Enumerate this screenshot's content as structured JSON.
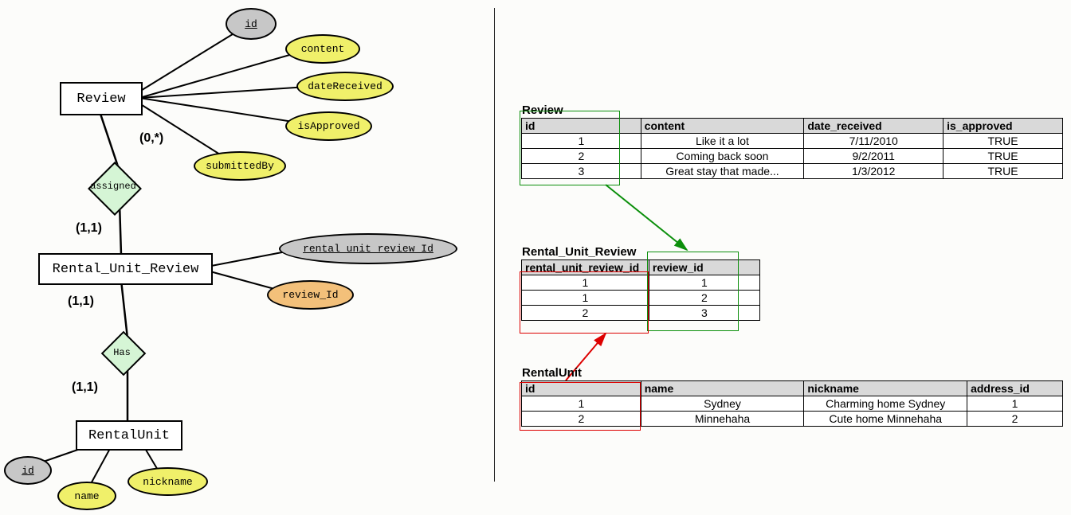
{
  "er": {
    "entities": {
      "review": "Review",
      "rur": "Rental_Unit_Review",
      "ru": "RentalUnit"
    },
    "attrs": {
      "id": "id",
      "content": "content",
      "dateReceived": "dateReceived",
      "isApproved": "isApproved",
      "submittedBy": "submittedBy",
      "rur_id": "rental_unit_review_Id",
      "review_id": "review_Id",
      "ru_id": "id",
      "ru_name": "name",
      "ru_nickname": "nickname"
    },
    "rels": {
      "assigned": "assigned",
      "has": "Has"
    },
    "cards": {
      "c0star": "(0,*)",
      "c11a": "(1,1)",
      "c11b": "(1,1)",
      "c11c": "(1,1)"
    }
  },
  "tables": {
    "review": {
      "title": "Review",
      "headers": [
        "id",
        "content",
        "date_received",
        "is_approved"
      ],
      "rows": [
        [
          "1",
          "Like it a lot",
          "7/11/2010",
          "TRUE"
        ],
        [
          "2",
          "Coming back soon",
          "9/2/2011",
          "TRUE"
        ],
        [
          "3",
          "Great stay that made...",
          "1/3/2012",
          "TRUE"
        ]
      ]
    },
    "rur": {
      "title": "Rental_Unit_Review",
      "headers": [
        "rental_unit_review_id",
        "review_id"
      ],
      "rows": [
        [
          "1",
          "1"
        ],
        [
          "1",
          "2"
        ],
        [
          "2",
          "3"
        ]
      ]
    },
    "ru": {
      "title": "RentalUnit",
      "headers": [
        "id",
        "name",
        "nickname",
        "address_id"
      ],
      "rows": [
        [
          "1",
          "Sydney",
          "Charming home Sydney",
          "1"
        ],
        [
          "2",
          "Minnehaha",
          "Cute home Minnehaha",
          "2"
        ]
      ]
    }
  }
}
